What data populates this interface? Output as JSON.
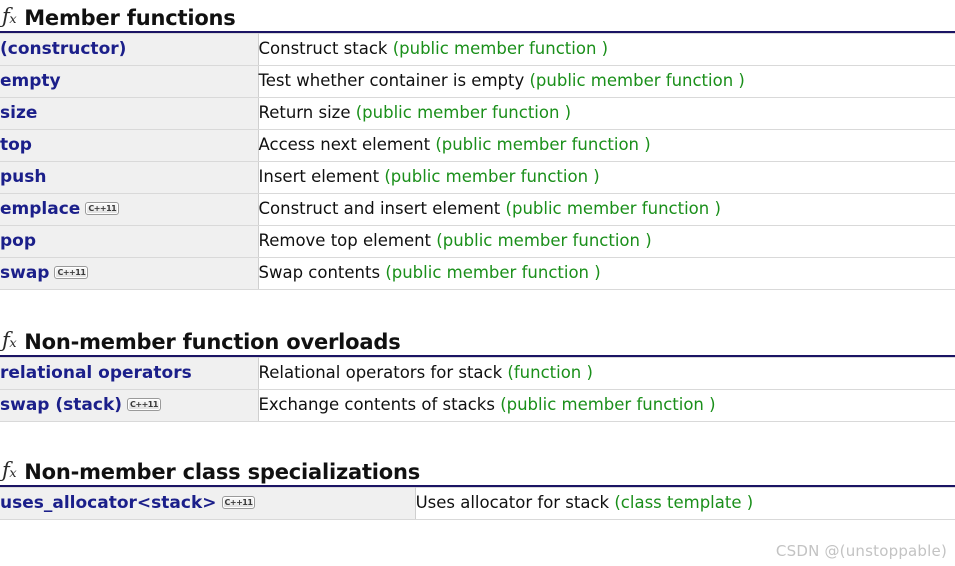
{
  "icons": {
    "fx": "ƒₓ",
    "cpp11_badge": "C++11"
  },
  "watermark": "CSDN @(unstoppable)",
  "sections": [
    {
      "title": "Member functions",
      "rows": [
        {
          "name": "(constructor)",
          "badge": "",
          "desc": "Construct stack ",
          "kind": "(public member function )"
        },
        {
          "name": "empty",
          "badge": "",
          "desc": "Test whether container is empty ",
          "kind": "(public member function )"
        },
        {
          "name": "size",
          "badge": "",
          "desc": "Return size ",
          "kind": "(public member function )"
        },
        {
          "name": "top",
          "badge": "",
          "desc": "Access next element ",
          "kind": "(public member function )"
        },
        {
          "name": "push",
          "badge": "",
          "desc": "Insert element ",
          "kind": "(public member function )"
        },
        {
          "name": "emplace",
          "badge": "C++11",
          "desc": "Construct and insert element ",
          "kind": "(public member function )"
        },
        {
          "name": "pop",
          "badge": "",
          "desc": "Remove top element ",
          "kind": "(public member function )"
        },
        {
          "name": "swap",
          "badge": "C++11",
          "desc": "Swap contents ",
          "kind": "(public member function )"
        }
      ]
    },
    {
      "title": "Non-member function overloads",
      "rows": [
        {
          "name": "relational operators",
          "badge": "",
          "desc": "Relational operators for stack ",
          "kind": "(function )"
        },
        {
          "name": "swap (stack)",
          "badge": "C++11",
          "desc": "Exchange contents of stacks ",
          "kind": "(public member function )"
        }
      ]
    },
    {
      "title": "Non-member class specializations",
      "rows": [
        {
          "name": "uses_allocator<stack>",
          "badge": "C++11",
          "desc": "Uses allocator for stack ",
          "kind": "(class template )"
        }
      ]
    }
  ]
}
